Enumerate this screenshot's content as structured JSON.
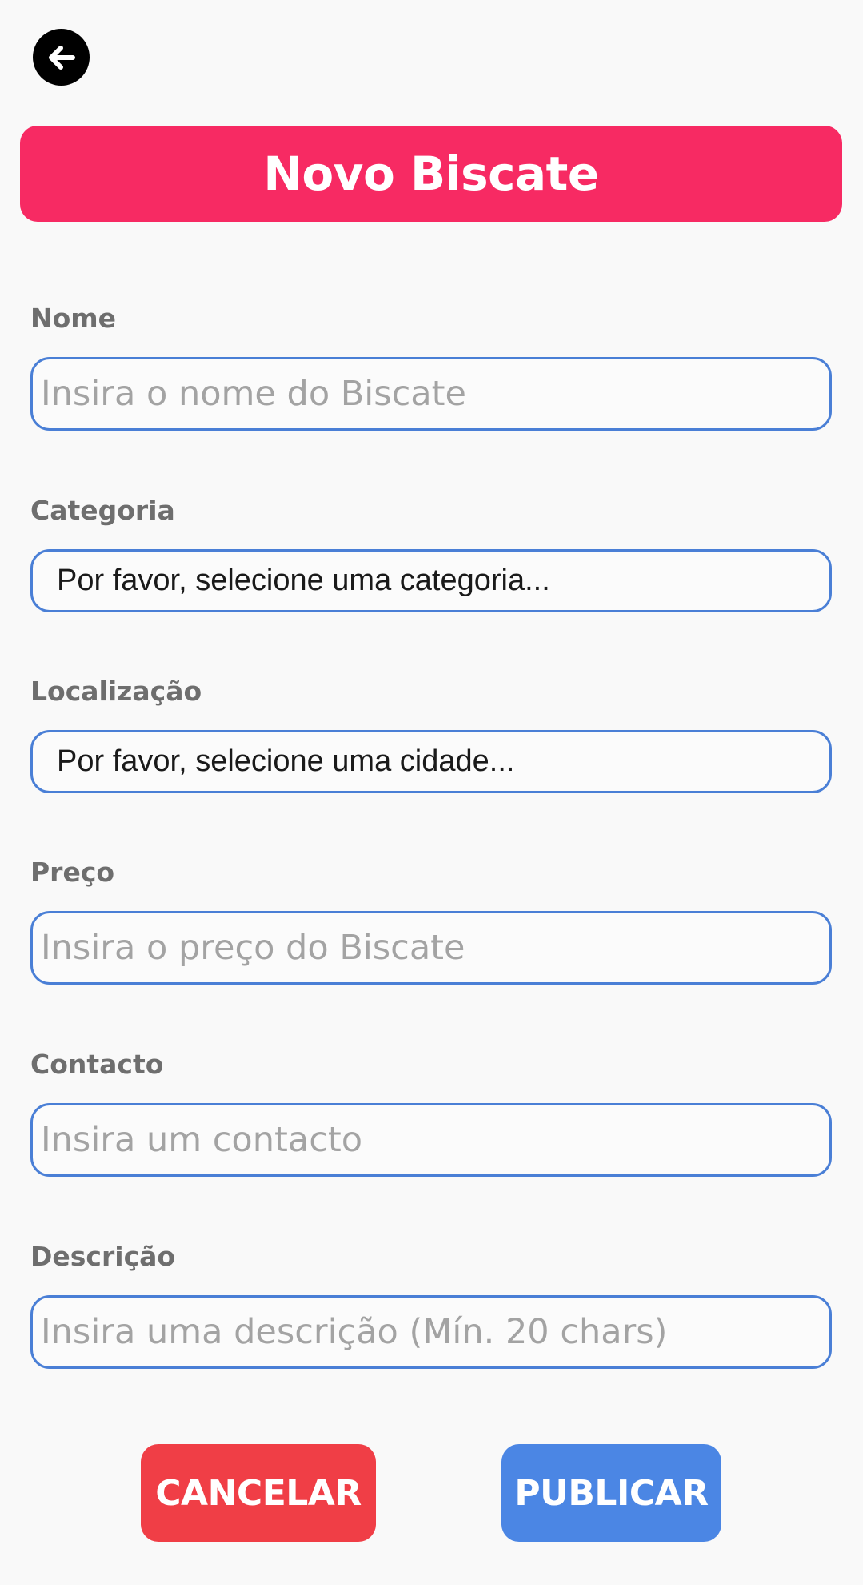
{
  "header": {
    "back_icon": "arrow-left-icon",
    "title": "Novo Biscate"
  },
  "form": {
    "nome": {
      "label": "Nome",
      "placeholder": "Insira o nome do Biscate",
      "value": ""
    },
    "categoria": {
      "label": "Categoria",
      "selected": "Por favor, selecione uma categoria..."
    },
    "localizacao": {
      "label": "Localização",
      "selected": "Por favor, selecione uma cidade..."
    },
    "preco": {
      "label": "Preço",
      "placeholder": "Insira o preço do Biscate",
      "value": ""
    },
    "contacto": {
      "label": "Contacto",
      "placeholder": "Insira um contacto",
      "value": ""
    },
    "descricao": {
      "label": "Descrição",
      "placeholder": "Insira uma descrição (Mín. 20 chars)",
      "value": ""
    }
  },
  "actions": {
    "cancel_label": "CANCELAR",
    "publish_label": "PUBLICAR"
  },
  "colors": {
    "title_banner": "#f72a63",
    "input_border": "#4a7fd6",
    "cancel": "#f03e46",
    "publish": "#4b86e4"
  }
}
